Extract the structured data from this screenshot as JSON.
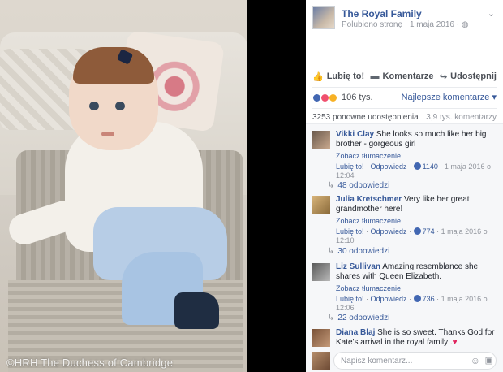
{
  "photo": {
    "credit": "©HRH The Duchess of Cambridge"
  },
  "post": {
    "page_name": "The Royal Family",
    "subtitle": "Polubiono stronę · 1 maja 2016 · ",
    "privacy_icon": "globe-icon",
    "menu_icon": "chevron-down-icon"
  },
  "actions": {
    "like": "Lubię to!",
    "comment": "Komentarze",
    "share": "Udostępnij"
  },
  "reactions": {
    "count": "106 tys.",
    "sort": "Najlepsze komentarze",
    "colors": [
      "#4267b2",
      "#f0506e",
      "#f7b125"
    ]
  },
  "stats": {
    "shares": "3253 ponowne udostępnienia",
    "comments": "3,9 tys. komentarzy"
  },
  "comments": [
    {
      "name": "Vikki Clay",
      "text": "She looks so much like her big brother - gorgeous girl",
      "translate": "Zobacz tłumaczenie",
      "like": "Lubię to!",
      "reply": "Odpowiedz",
      "likes": "1140",
      "time": "1 maja 2016 o 12:04",
      "replies": "48 odpowiedzi"
    },
    {
      "name": "Julia Kretschmer",
      "text": "Very like her great grandmother here!",
      "translate": "Zobacz tłumaczenie",
      "like": "Lubię to!",
      "reply": "Odpowiedz",
      "likes": "774",
      "time": "1 maja 2016 o 12:10",
      "replies": "30 odpowiedzi"
    },
    {
      "name": "Liz Sullivan",
      "text": "Amazing resemblance she shares with Queen Elizabeth.",
      "translate": "Zobacz tłumaczenie",
      "like": "Lubię to!",
      "reply": "Odpowiedz",
      "likes": "736",
      "time": "1 maja 2016 o 12:06",
      "replies": "22 odpowiedzi"
    },
    {
      "name": "Diana Blaj",
      "text": "She is so sweet. Thanks God for Kate's arrival in the royal family ."
    }
  ],
  "composer": {
    "placeholder": "Napisz komentarz..."
  }
}
